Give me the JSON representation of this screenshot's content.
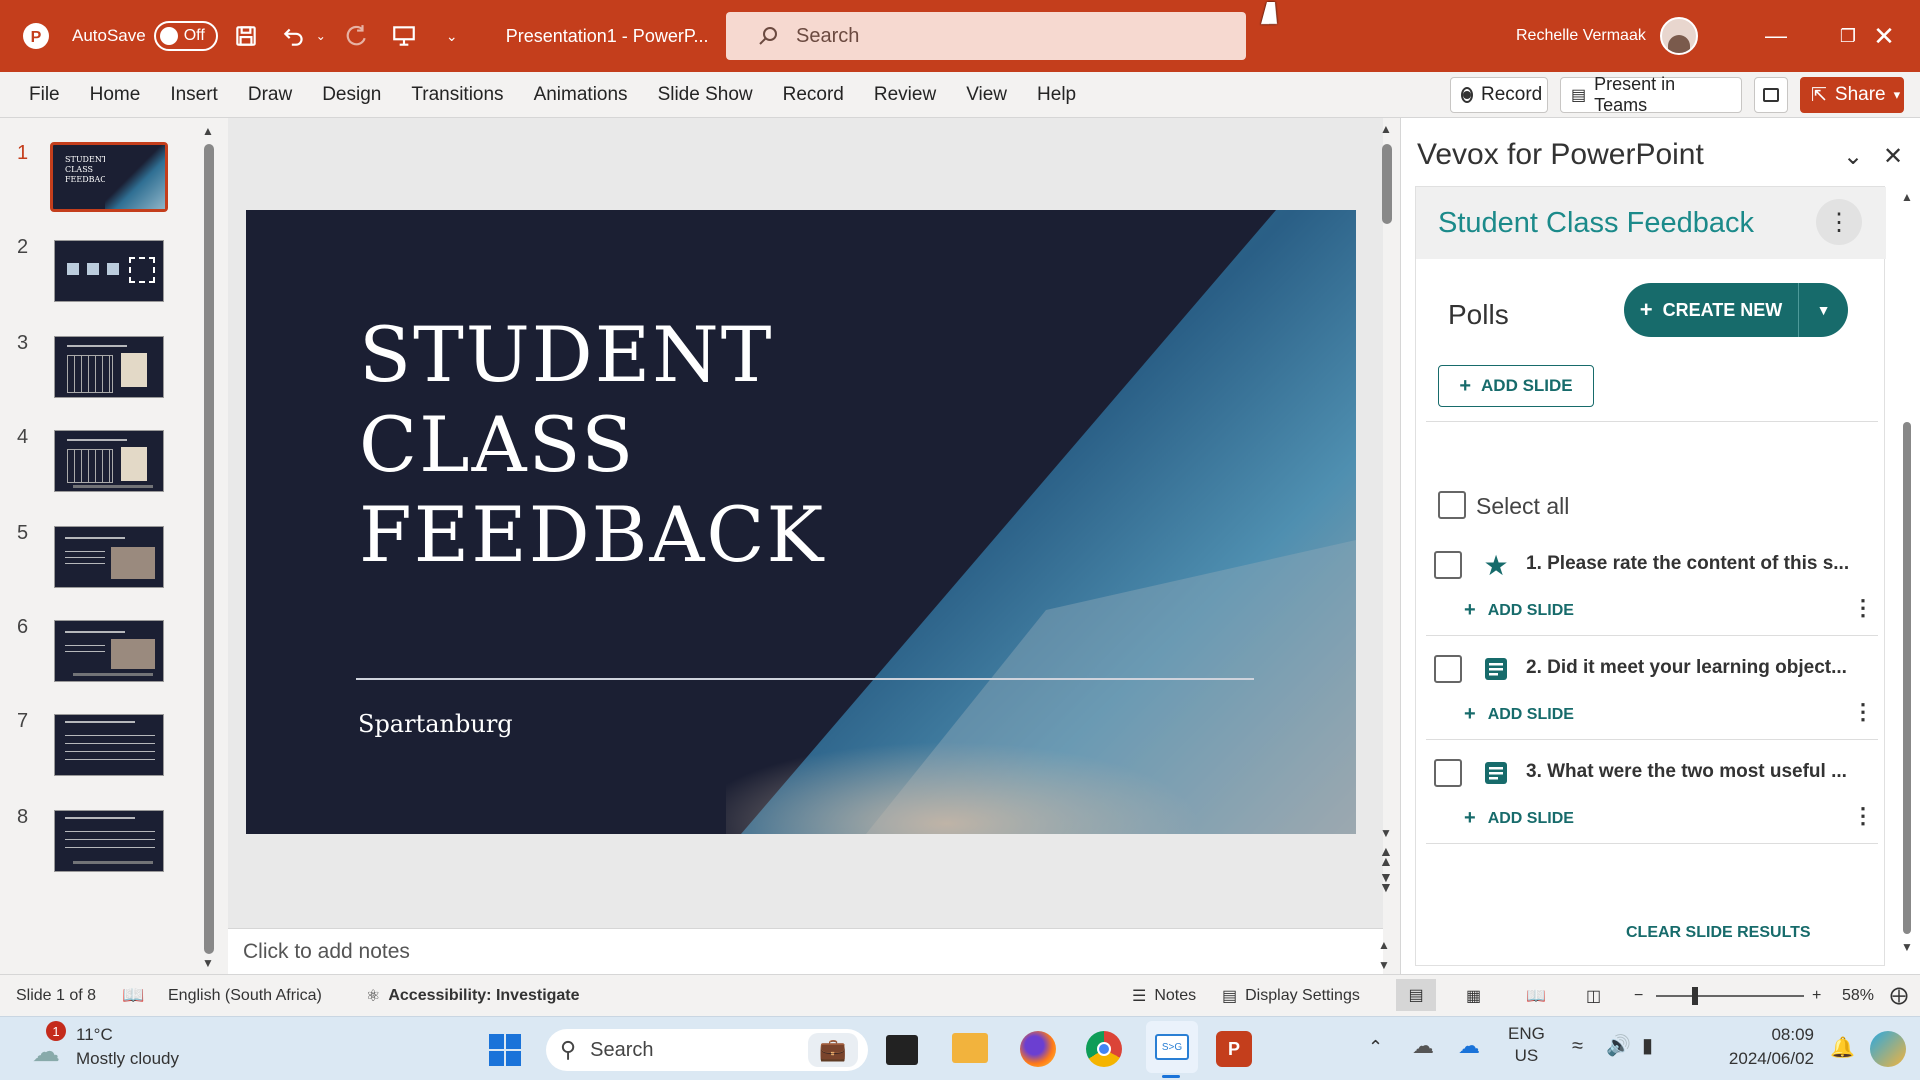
{
  "titlebar": {
    "autosave_label": "AutoSave",
    "autosave_state": "Off",
    "doc_title": "Presentation1  -  PowerP...",
    "search_placeholder": "Search",
    "user_name": "Rechelle Vermaak"
  },
  "ribbon": {
    "tabs": [
      "File",
      "Home",
      "Insert",
      "Draw",
      "Design",
      "Transitions",
      "Animations",
      "Slide Show",
      "Record",
      "Review",
      "View",
      "Help"
    ],
    "record_label": "Record",
    "present_label": "Present in Teams",
    "share_label": "Share"
  },
  "thumbnails": [
    "1",
    "2",
    "3",
    "4",
    "5",
    "6",
    "7",
    "8"
  ],
  "slide": {
    "title": "STUDENT\nCLASS\nFEEDBACK",
    "subtitle": "Spartanburg"
  },
  "notes_placeholder": "Click to add notes",
  "addin": {
    "pane_title": "Vevox for PowerPoint",
    "session_title": "Student Class Feedback",
    "polls_label": "Polls",
    "create_new": "CREATE NEW",
    "add_slide": "ADD SLIDE",
    "select_all": "Select all",
    "polls": [
      {
        "text": "1. Please rate the content of this s...",
        "icon": "star-icon"
      },
      {
        "text": "2. Did it meet your learning object...",
        "icon": "text-response-icon"
      },
      {
        "text": "3. What were the two most useful ...",
        "icon": "text-response-icon"
      }
    ],
    "clear_results": "CLEAR SLIDE RESULTS"
  },
  "status": {
    "slide_info": "Slide 1 of 8",
    "language": "English (South Africa)",
    "accessibility": "Accessibility: Investigate",
    "notes": "Notes",
    "display_settings": "Display Settings",
    "zoom": "58%"
  },
  "taskbar": {
    "weather_temp": "11°C",
    "weather_desc": "Mostly cloudy",
    "weather_badge": "1",
    "search_label": "Search",
    "lang_line1": "ENG",
    "lang_line2": "US",
    "time": "08:09",
    "date": "2024/06/02"
  },
  "colors": {
    "accent": "#c43e1c",
    "vevox_teal": "#176b6b",
    "slide_bg": "#1b1f33"
  }
}
